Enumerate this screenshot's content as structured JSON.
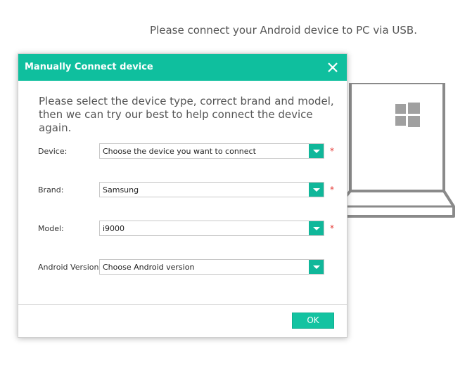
{
  "background": {
    "message": "Please connect your Android device to PC via USB."
  },
  "dialog": {
    "title": "Manually Connect device",
    "intro": "Please select the device type, correct brand and model, then we can try our best to help connect the device again.",
    "fields": [
      {
        "label": "Device:",
        "value": "Choose the device you want to connect",
        "required": "*"
      },
      {
        "label": "Brand:",
        "value": "Samsung",
        "required": "*"
      },
      {
        "label": "Model:",
        "value": "i9000",
        "required": "*"
      },
      {
        "label": "Android Version:",
        "value": "Choose Android version",
        "required": ""
      }
    ],
    "ok_label": "OK"
  },
  "colors": {
    "accent": "#0fbf9e",
    "required": "#e53935"
  },
  "icons": [
    "close-icon",
    "laptop-icon",
    "windows-logo-icon",
    "dropdown-arrow-icon"
  ]
}
